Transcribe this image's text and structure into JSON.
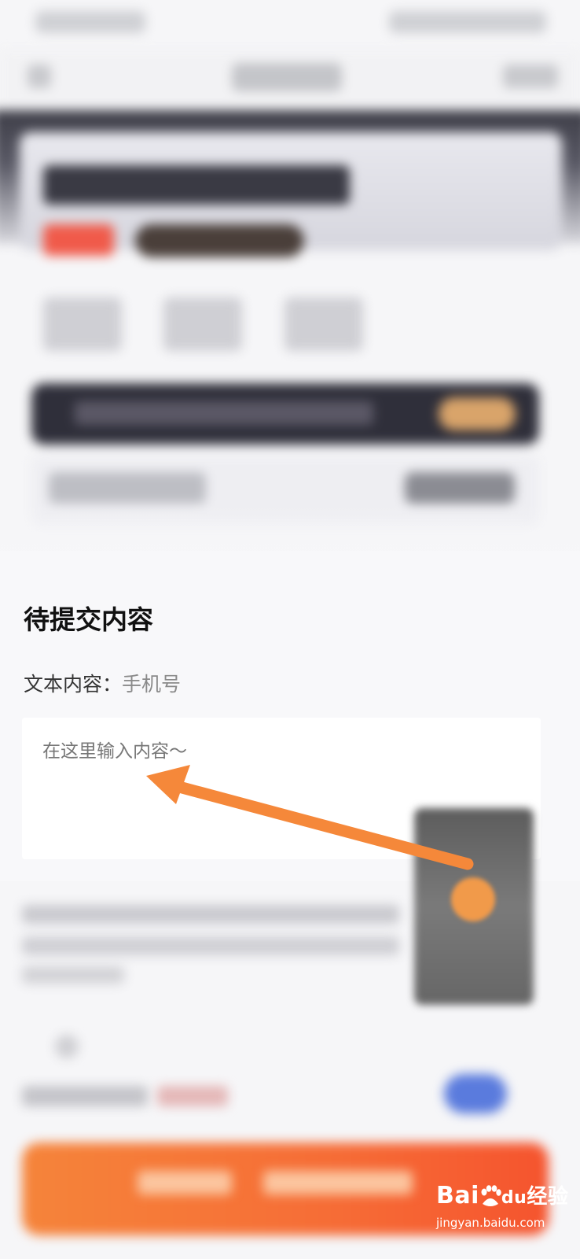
{
  "content": {
    "section_title": "待提交内容",
    "text_content_label": "文本内容：",
    "text_content_value": "手机号",
    "input": {
      "placeholder": "在这里输入内容～",
      "value": ""
    }
  },
  "watermark": {
    "logo_prefix": "Bai",
    "logo_mid": "du",
    "logo_suffix": "经验",
    "url": "jingyan.baidu.com"
  },
  "colors": {
    "arrow": "#f5883a",
    "primary_button": "#f66c36",
    "toggle": "#5a7bdd"
  },
  "icons": {
    "arrow": "annotation-arrow-icon",
    "watermark": "baidu-paw-icon"
  }
}
